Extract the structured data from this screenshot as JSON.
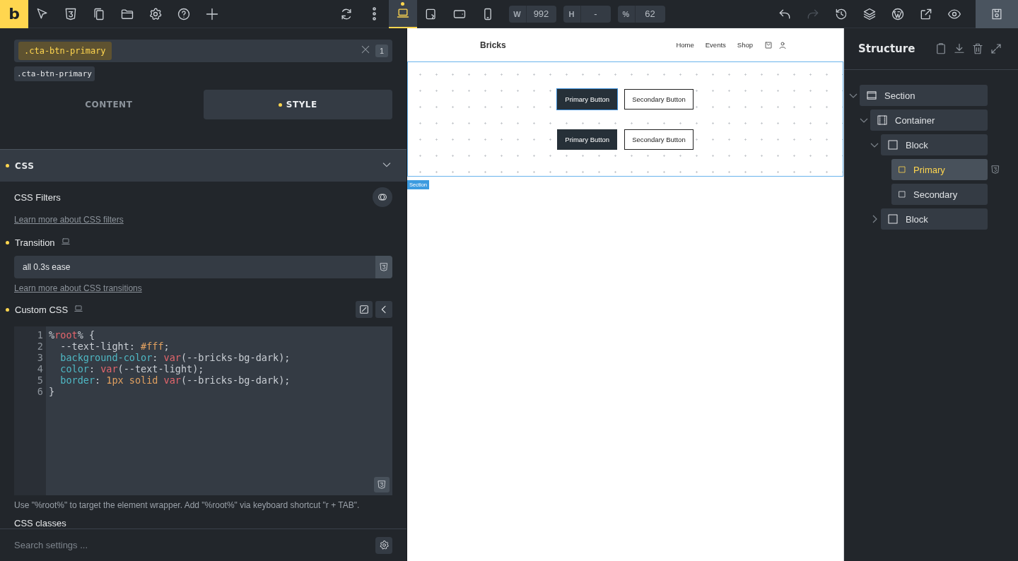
{
  "toolbar": {
    "logo": "b",
    "tools": [
      {
        "kind": "cursor"
      },
      {
        "kind": "css"
      },
      {
        "kind": "copy"
      },
      {
        "kind": "folder"
      },
      {
        "kind": "settings"
      },
      {
        "kind": "help"
      },
      {
        "kind": "plus"
      }
    ],
    "sync": [
      {
        "kind": "refresh"
      },
      {
        "kind": "more"
      }
    ],
    "devices": [
      {
        "kind": "laptop",
        "selected": true
      },
      {
        "kind": "tablet",
        "selected": false
      },
      {
        "kind": "landscape",
        "selected": false
      },
      {
        "kind": "phone",
        "selected": false
      }
    ],
    "size_fields": [
      {
        "label": "W",
        "value": "992"
      },
      {
        "label": "H",
        "value": "-"
      },
      {
        "label": "%",
        "value": "62"
      }
    ],
    "actions": [
      {
        "kind": "undo",
        "disabled": false
      },
      {
        "kind": "redo",
        "disabled": true
      },
      {
        "kind": "history",
        "disabled": false
      },
      {
        "kind": "layers",
        "disabled": false
      },
      {
        "kind": "wordpress",
        "disabled": false
      },
      {
        "kind": "external",
        "disabled": false
      },
      {
        "kind": "eye",
        "disabled": false
      }
    ],
    "save": {
      "kind": "save"
    }
  },
  "class_selector": {
    "tag": ".cta-btn-primary",
    "count": "1",
    "chip": ".cta-btn-primary"
  },
  "tabs": [
    {
      "label": "CONTENT",
      "selected": false,
      "modified": false
    },
    {
      "label": "STYLE",
      "selected": true,
      "modified": true
    }
  ],
  "css_section": {
    "title": "CSS",
    "modified": true,
    "expanded": true,
    "filters": {
      "label": "CSS Filters",
      "link": "Learn more about CSS filters"
    },
    "transition": {
      "label": "Transition",
      "modified": true,
      "value": "all 0.3s ease",
      "link": "Learn more about CSS transitions"
    },
    "custom_css": {
      "label": "Custom CSS",
      "modified": true,
      "lines": [
        {
          "number": "1",
          "tokens": [
            {
              "kind": "plain",
              "text": "%"
            },
            {
              "kind": "selector",
              "text": "root"
            },
            {
              "kind": "plain",
              "text": "% {"
            }
          ]
        },
        {
          "number": "2",
          "tokens": [
            {
              "kind": "plain",
              "text": "  --text-light: "
            },
            {
              "kind": "value",
              "text": "#fff"
            },
            {
              "kind": "plain",
              "text": ";"
            }
          ]
        },
        {
          "number": "3",
          "tokens": [
            {
              "kind": "property",
              "text": "  background-color"
            },
            {
              "kind": "plain",
              "text": ": "
            },
            {
              "kind": "function",
              "text": "var"
            },
            {
              "kind": "plain",
              "text": "(--bricks-bg-dark);"
            }
          ]
        },
        {
          "number": "4",
          "tokens": [
            {
              "kind": "property",
              "text": "  color"
            },
            {
              "kind": "plain",
              "text": ": "
            },
            {
              "kind": "function",
              "text": "var"
            },
            {
              "kind": "plain",
              "text": "(--text-light);"
            }
          ]
        },
        {
          "number": "5",
          "tokens": [
            {
              "kind": "property",
              "text": "  border"
            },
            {
              "kind": "plain",
              "text": ": "
            },
            {
              "kind": "value",
              "text": "1px solid "
            },
            {
              "kind": "function",
              "text": "var"
            },
            {
              "kind": "plain",
              "text": "(--bricks-bg-dark);"
            }
          ]
        },
        {
          "number": "6",
          "tokens": [
            {
              "kind": "plain",
              "text": "}"
            }
          ]
        }
      ]
    },
    "hint": "Use \"%root%\" to target the element wrapper. Add \"%root%\" via keyboard shortcut \"r + TAB\".",
    "classes_label": "CSS classes"
  },
  "search": {
    "placeholder": "Search settings ..."
  },
  "canvas": {
    "brand": "Bricks",
    "nav": [
      "Home",
      "Events",
      "Shop"
    ],
    "button_rows": [
      [
        {
          "kind": "primary",
          "label": "Primary Button",
          "selected": true
        },
        {
          "kind": "secondary",
          "label": "Secondary Button",
          "selected": false
        }
      ],
      [
        {
          "kind": "primary",
          "label": "Primary Button",
          "selected": false
        },
        {
          "kind": "secondary",
          "label": "Secondary Button",
          "selected": false
        }
      ]
    ],
    "section_label": "Section"
  },
  "structure": {
    "title": "Structure",
    "tree": [
      {
        "label": "Section",
        "kind": "section",
        "expanded": true,
        "selected": false,
        "children": [
          {
            "label": "Container",
            "kind": "container",
            "expanded": true,
            "selected": false,
            "children": [
              {
                "label": "Block",
                "kind": "block",
                "expanded": true,
                "selected": false,
                "children": [
                  {
                    "label": "Primary",
                    "kind": "item",
                    "selected": true,
                    "has_css": true
                  },
                  {
                    "label": "Secondary",
                    "kind": "item",
                    "selected": false,
                    "has_css": false
                  }
                ]
              },
              {
                "label": "Block",
                "kind": "block",
                "expanded": false,
                "selected": false
              }
            ]
          }
        ]
      }
    ]
  }
}
